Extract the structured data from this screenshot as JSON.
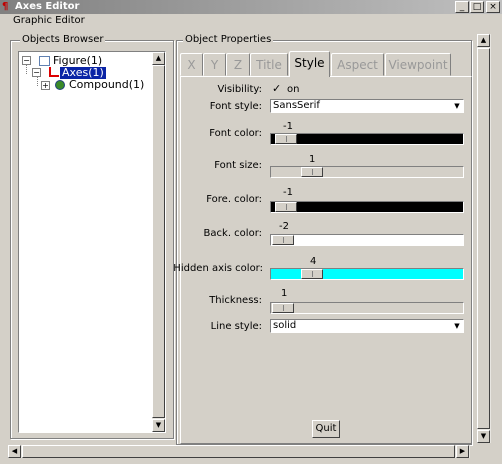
{
  "window": {
    "title": "Axes Editor",
    "icon_name": "app-icon",
    "min": "_",
    "max": "□",
    "close": "×"
  },
  "menu": {
    "item": "Graphic Editor"
  },
  "browser": {
    "title": "Objects Browser",
    "nodes": [
      "Figure(1)",
      "Axes(1)",
      "Compound(1)"
    ]
  },
  "properties": {
    "title": "Object Properties",
    "tabs": [
      "X",
      "Y",
      "Z",
      "Title",
      "Style",
      "Aspect",
      "Viewpoint"
    ],
    "active_tab": "Style",
    "visibility_label": "Visibility:",
    "visibility_value": "on",
    "font_style_label": "Font style:",
    "font_style_value": "SansSerif",
    "font_color_label": "Font color:",
    "font_color_value": "-1",
    "font_size_label": "Font size:",
    "font_size_value": "1",
    "fore_color_label": "Fore. color:",
    "fore_color_value": "-1",
    "back_color_label": "Back. color:",
    "back_color_value": "-2",
    "hidden_axis_label": "Hidden axis color:",
    "hidden_axis_value": "4",
    "thickness_label": "Thickness:",
    "thickness_value": "1",
    "line_style_label": "Line style:",
    "line_style_value": "solid",
    "quit_label": "Quit"
  },
  "colors": {
    "font": "#000000",
    "fore": "#000000",
    "back": "#ffffff",
    "hidden_axis": "#00ffff",
    "selection": "#0a24a6"
  }
}
